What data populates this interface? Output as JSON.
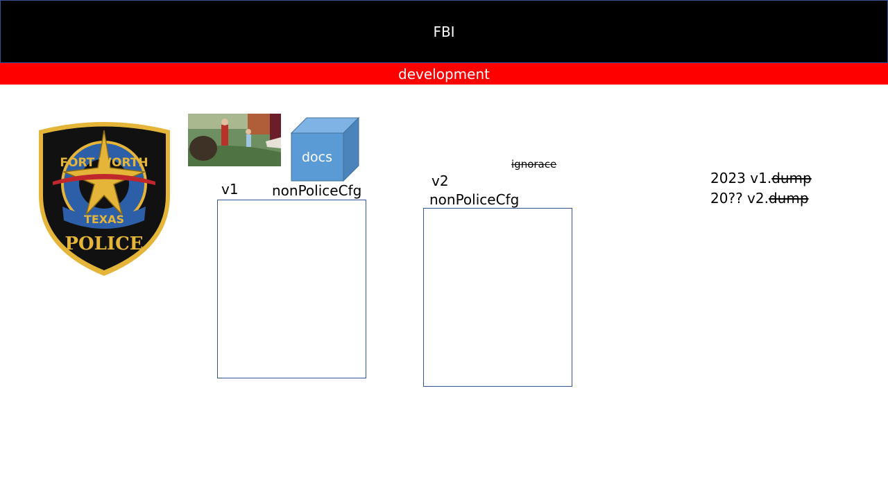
{
  "header": {
    "title": "FBI"
  },
  "env_bar": {
    "label": "development"
  },
  "badge": {
    "top_text": "FORT WORTH",
    "middle_text": "TEXAS",
    "bottom_text": "POLICE",
    "colors": {
      "gold": "#e5b53a",
      "black": "#111111",
      "blue": "#2d5fa8",
      "red": "#c0272d"
    }
  },
  "cube": {
    "label": "docs",
    "colors": {
      "front": "#5b9bd5",
      "top": "#7fb2e5",
      "side": "#4a84bb"
    }
  },
  "panels": {
    "v1": {
      "version": "v1",
      "name": "nonPoliceCfg"
    },
    "v2": {
      "version": "v2",
      "name": "nonPoliceCfg",
      "note": "ignorace"
    }
  },
  "dumps": [
    {
      "prefix": "2023 v1.",
      "struck": "dump"
    },
    {
      "prefix": "20?? v2.",
      "struck": "dump"
    }
  ]
}
